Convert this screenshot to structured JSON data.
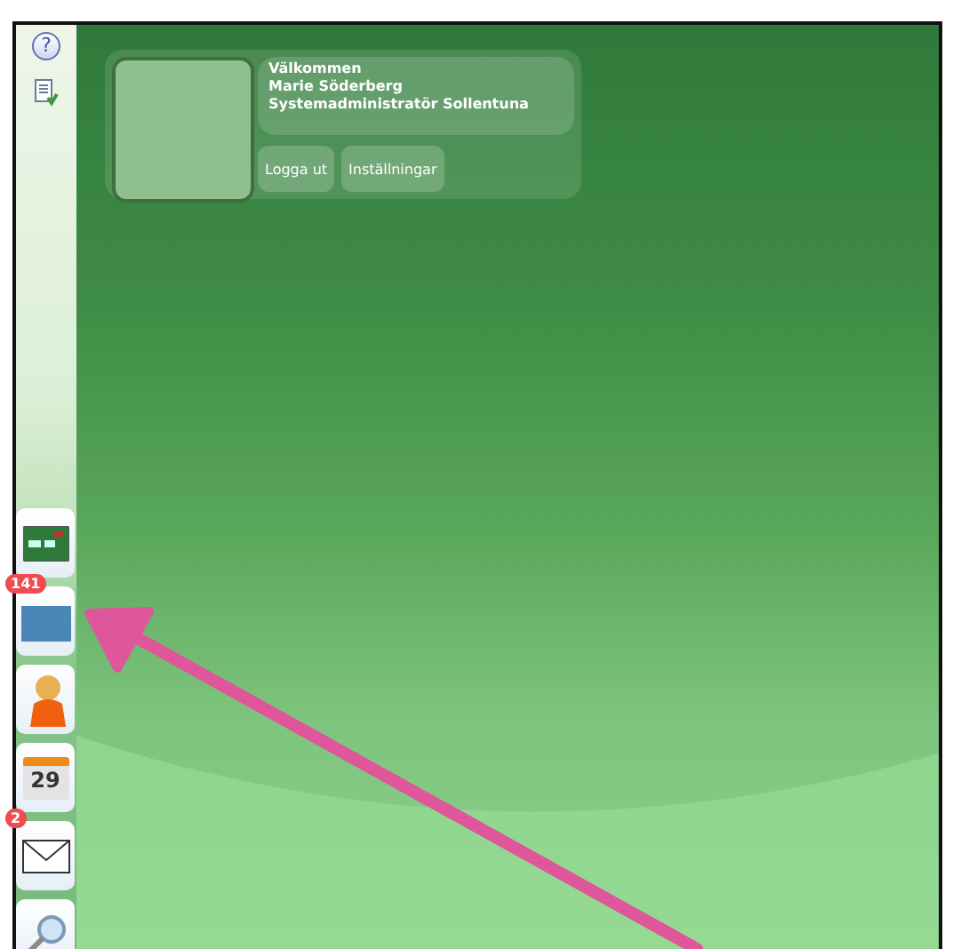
{
  "sidebar": {
    "help_button": "?"
  },
  "profile": {
    "lines": [
      "Välkommen",
      "Marie Söderberg",
      "Systemadministratör Sollentuna"
    ],
    "buttons": [
      "Logga ut",
      "Inställningar"
    ]
  },
  "dock": [
    {
      "kind": "card"
    },
    {
      "kind": "folder",
      "badge": "141"
    },
    {
      "kind": "person"
    },
    {
      "kind": "calendar",
      "text": "29"
    },
    {
      "kind": "mail",
      "badge": "2"
    },
    {
      "kind": "search"
    }
  ],
  "annotation": {
    "kind": "arrow"
  }
}
